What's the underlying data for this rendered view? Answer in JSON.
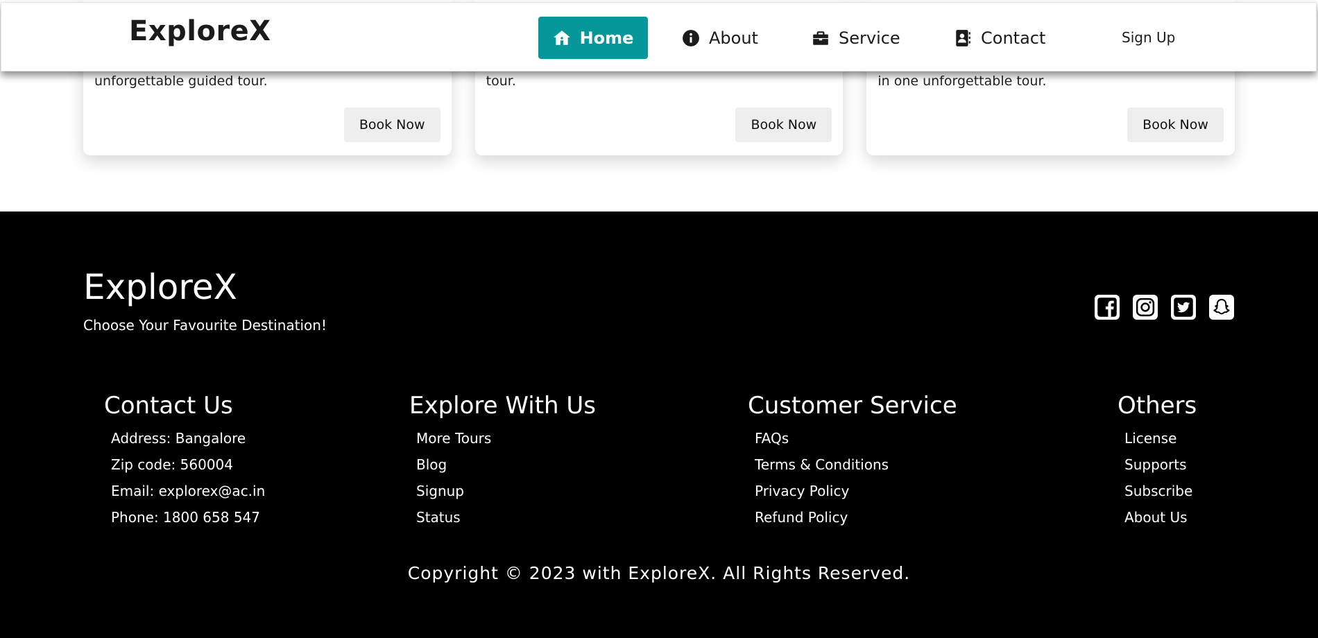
{
  "brand": "ExploreX",
  "navbar": {
    "items": [
      {
        "label": "Home",
        "icon": "home-icon"
      },
      {
        "label": "About",
        "icon": "info-icon"
      },
      {
        "label": "Service",
        "icon": "briefcase-icon"
      },
      {
        "label": "Contact",
        "icon": "contact-book-icon"
      }
    ],
    "signup": "Sign Up",
    "active_color": "#06979a"
  },
  "cards": [
    {
      "description": "unforgettable guided tour.",
      "button": "Book Now"
    },
    {
      "description": "tour.",
      "button": "Book Now"
    },
    {
      "description": "in one unforgettable tour.",
      "button": "Book Now"
    }
  ],
  "footer": {
    "brand": "ExploreX",
    "tagline": "Choose Your Favourite Destination!",
    "socials": [
      "facebook-icon",
      "instagram-icon",
      "twitter-icon",
      "snapchat-icon"
    ],
    "columns": [
      {
        "title": "Contact Us",
        "items": [
          "Address: Bangalore",
          "Zip code: 560004",
          "Email: explorex@ac.in",
          "Phone: 1800 658 547"
        ]
      },
      {
        "title": "Explore With Us",
        "items": [
          "More Tours",
          "Blog",
          "Signup",
          "Status"
        ]
      },
      {
        "title": "Customer Service",
        "items": [
          "FAQs",
          "Terms & Conditions",
          "Privacy Policy",
          "Refund Policy"
        ]
      },
      {
        "title": "Others",
        "items": [
          "License",
          "Supports",
          "Subscribe",
          "About Us"
        ]
      }
    ],
    "copyright": "Copyright © 2023 with ExploreX. All Rights Reserved."
  }
}
